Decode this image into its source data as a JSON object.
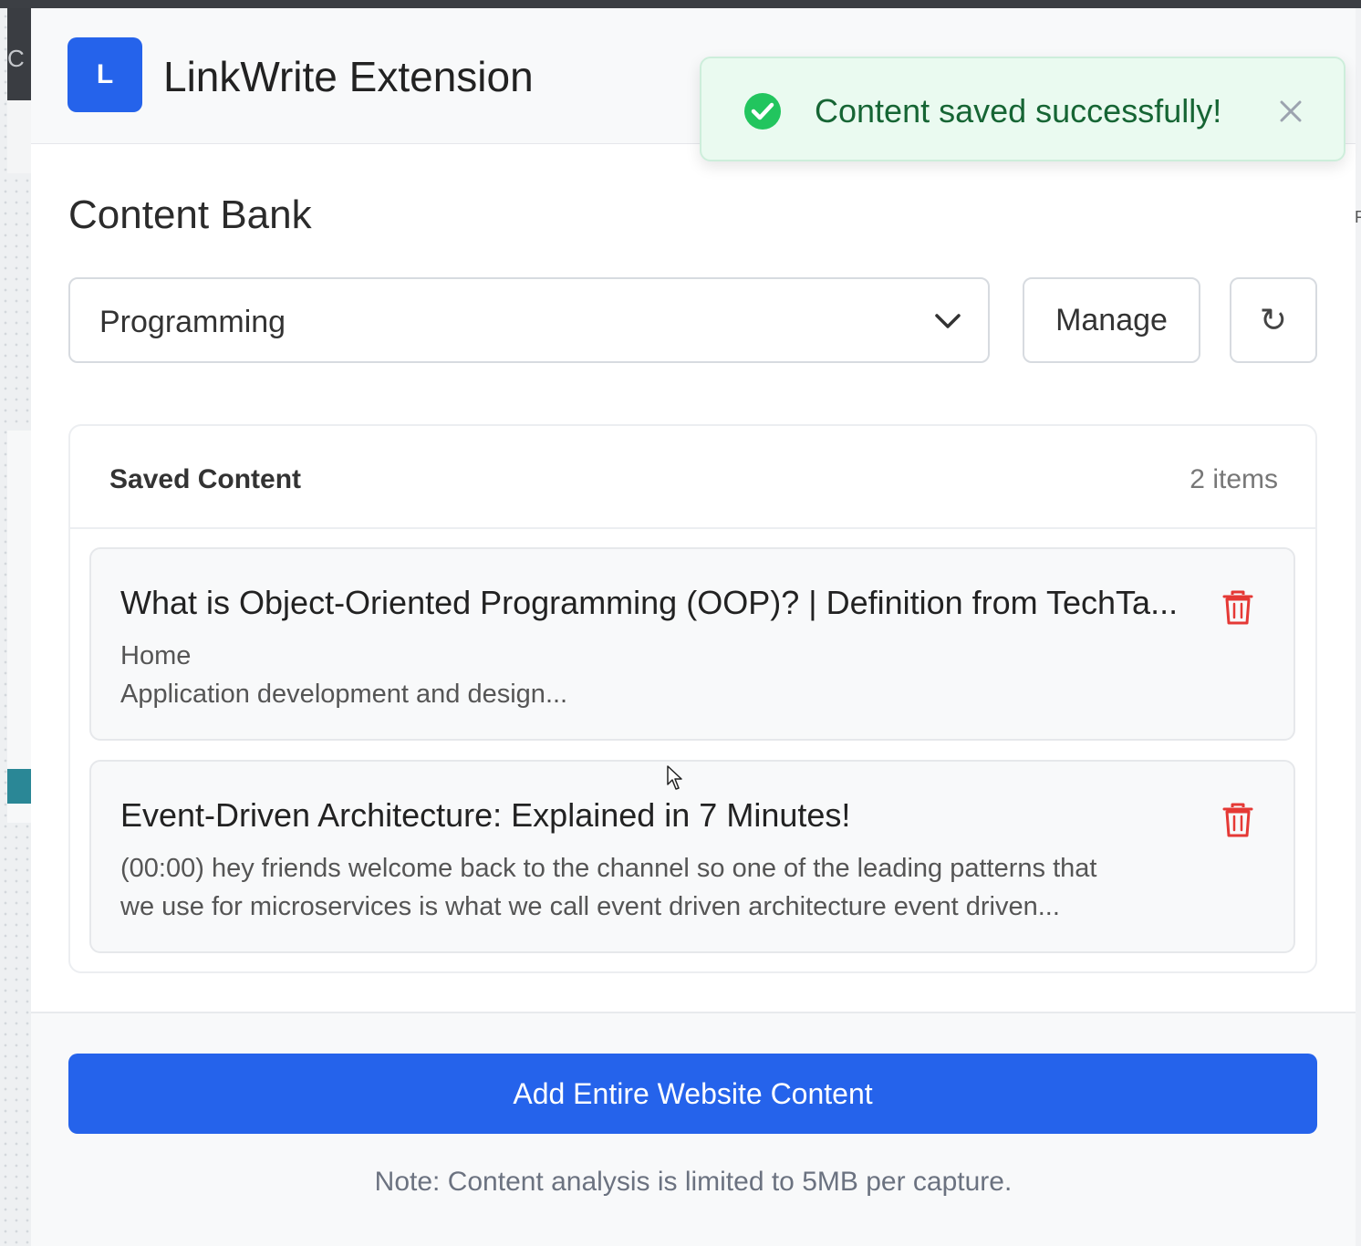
{
  "header": {
    "logo_letter": "L",
    "title": "LinkWrite Extension"
  },
  "toast": {
    "message": "Content saved successfully!",
    "icon": "check-circle-icon",
    "close_icon": "close-icon",
    "color": "#22c55e"
  },
  "content_bank": {
    "title": "Content Bank",
    "category_select": {
      "selected": "Programming"
    },
    "manage_label": "Manage",
    "refresh_symbol": "↻"
  },
  "saved": {
    "title": "Saved Content",
    "count_label": "2 items",
    "items": [
      {
        "title": "What is Object-Oriented Programming (OOP)? | Definition from TechTa...",
        "lines": [
          "Home",
          "Application development and design..."
        ]
      },
      {
        "title": "Event-Driven Architecture: Explained in 7 Minutes!",
        "lines": [
          "(00:00) hey friends welcome back to the channel so one of the leading patterns that",
          "we use for microservices is what we call event driven architecture event driven..."
        ]
      }
    ]
  },
  "footer": {
    "add_button_label": "Add Entire Website Content",
    "note": "Note: Content analysis is limited to 5MB per capture."
  },
  "colors": {
    "primary": "#2563eb",
    "success": "#22c55e",
    "danger": "#e53935"
  }
}
